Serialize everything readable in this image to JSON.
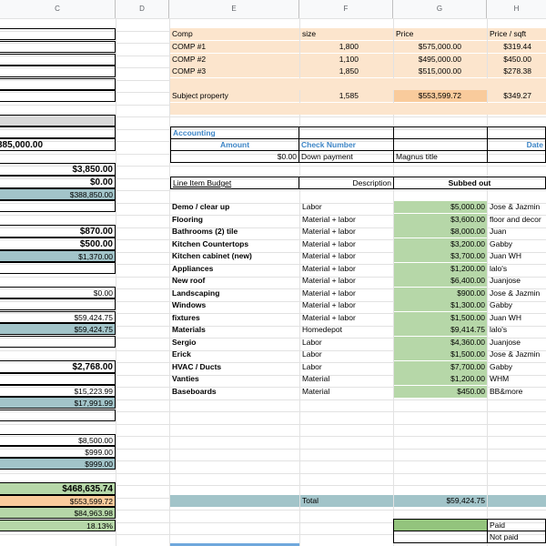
{
  "columns": [
    "C",
    "D",
    "E",
    "F",
    "G",
    "H"
  ],
  "comps": {
    "headers": [
      "Comp",
      "size",
      "Price",
      "Price / sqft"
    ],
    "rows": [
      [
        "COMP #1",
        "1,800",
        "$575,000.00",
        "$319.44"
      ],
      [
        "COMP #2",
        "1,100",
        "$495,000.00",
        "$450.00"
      ],
      [
        "COMP #3",
        "1,850",
        "$515,000.00",
        "$278.38"
      ]
    ],
    "subject": [
      "Subject property",
      "1,585",
      "$553,599.72",
      "$349.27"
    ]
  },
  "accounting": {
    "title": "Accounting",
    "amount_label": "Amount",
    "check_label": "Check Number",
    "date_label": "Date",
    "row": [
      "$0.00",
      "Down payment",
      "Magnus title"
    ]
  },
  "budget": {
    "title": "Line Item Budget",
    "desc_label": "Description",
    "subbed_label": "Subbed out",
    "items": [
      [
        "Demo / clear up",
        "Labor",
        "$5,000.00",
        "Jose & Jazmin"
      ],
      [
        "Flooring",
        "Material + labor",
        "$3,600.00",
        "floor and decor"
      ],
      [
        "Bathrooms (2) tile",
        "Material + labor",
        "$8,000.00",
        "Juan"
      ],
      [
        "Kitchen Countertops",
        "Material + labor",
        "$3,200.00",
        "Gabby"
      ],
      [
        "Kitchen cabinet (new)",
        "Material + labor",
        "$3,700.00",
        "Juan WH"
      ],
      [
        "Appliances",
        "Material + labor",
        "$1,200.00",
        "lalo's"
      ],
      [
        "New roof",
        "Material + labor",
        "$6,400.00",
        "Juanjose"
      ],
      [
        "Landscaping",
        "Material + labor",
        "$900.00",
        "Jose & Jazmin"
      ],
      [
        "Windows",
        "Material + labor",
        "$1,300.00",
        "Gabby"
      ],
      [
        "fixtures",
        "Material + labor",
        "$1,500.00",
        "Juan WH"
      ],
      [
        "Materials",
        "Homedepot",
        "$9,414.75",
        "lalo's"
      ],
      [
        "Sergio",
        "Labor",
        "$4,360.00",
        "Juanjose"
      ],
      [
        "Erick",
        "Labor",
        "$1,500.00",
        "Jose & Jazmin"
      ],
      [
        "HVAC / Ducts",
        "Labor",
        "$7,700.00",
        "Gabby"
      ],
      [
        "Vanties",
        "Material",
        "$1,200.00",
        "WHM"
      ],
      [
        "Baseboards",
        "Material",
        "$450.00",
        "BB&more"
      ]
    ],
    "total_label": "Total",
    "total_value": "$59,424.75"
  },
  "legend": {
    "paid": "Paid",
    "not_paid": "Not paid"
  },
  "left": {
    "v1": "385,000.00",
    "v2": "$3,850.00",
    "v3": "$0.00",
    "v4": "$388,850.00",
    "v5": "$870.00",
    "v6": "$500.00",
    "v7": "$1,370.00",
    "v8": "$0.00",
    "v9": "$59,424.75",
    "v10": "$59,424.75",
    "v11": "$2,768.00",
    "v12": "$15,223.99",
    "v13": "$17,991.99",
    "v14": "$8,500.00",
    "v15": "$999.00",
    "v16": "$999.00",
    "v17": "$468,635.74",
    "v18": "$553,599.72",
    "v19": "$84,963.98",
    "v20": "18.13%"
  },
  "colors": {
    "peach": "#fce5cd",
    "orange": "#f9cb9c",
    "green": "#b6d7a8",
    "teal": "#a2c4c9"
  }
}
